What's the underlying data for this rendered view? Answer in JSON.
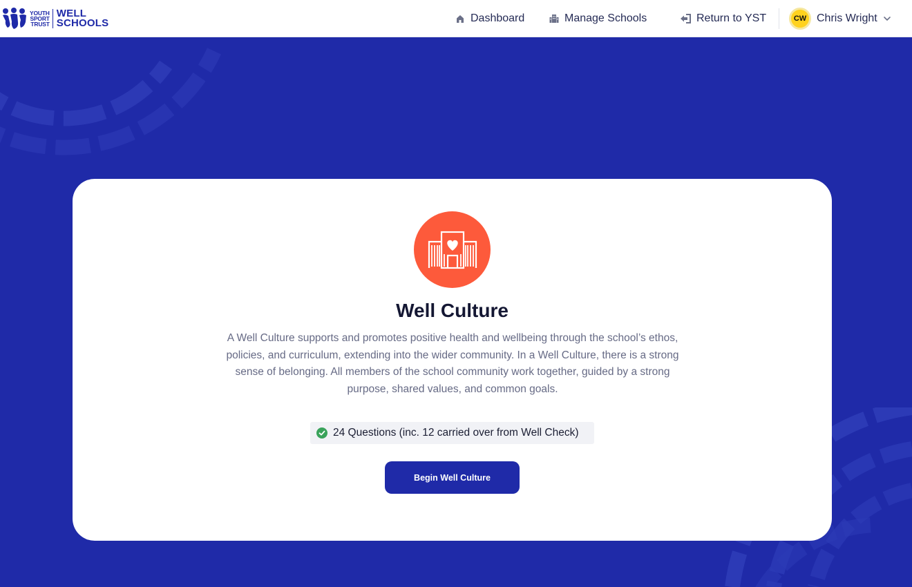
{
  "header": {
    "logo": {
      "org_lines": [
        "YOUTH",
        "SPORT",
        "TRUST"
      ],
      "product_lines": [
        "WELL",
        "SCHOOLS"
      ]
    },
    "nav": [
      {
        "label": "Dashboard",
        "icon": "home-icon"
      },
      {
        "label": "Manage Schools",
        "icon": "building-icon"
      },
      {
        "label": "Return to YST",
        "icon": "return-icon"
      }
    ],
    "user": {
      "initials": "CW",
      "name": "Chris Wright",
      "icon": "chevron-down-icon"
    }
  },
  "card": {
    "icon": "school-heart-icon",
    "title": "Well Culture",
    "description": "A Well Culture supports and promotes positive health and wellbeing through the school’s ethos, policies, and curriculum, extending into the wider community. In a Well Culture, there is a strong sense of belonging. All members of the school community work together, guided by a strong purpose, shared values, and common goals.",
    "questions_label": "24 Questions (inc. 12 carried over from Well Check)",
    "begin_label": "Begin Well Culture"
  },
  "colors": {
    "brand_blue": "#1f2aa8",
    "accent_orange": "#fd5a3b",
    "avatar_yellow": "#ffd21f",
    "check_green": "#3aa35b"
  }
}
